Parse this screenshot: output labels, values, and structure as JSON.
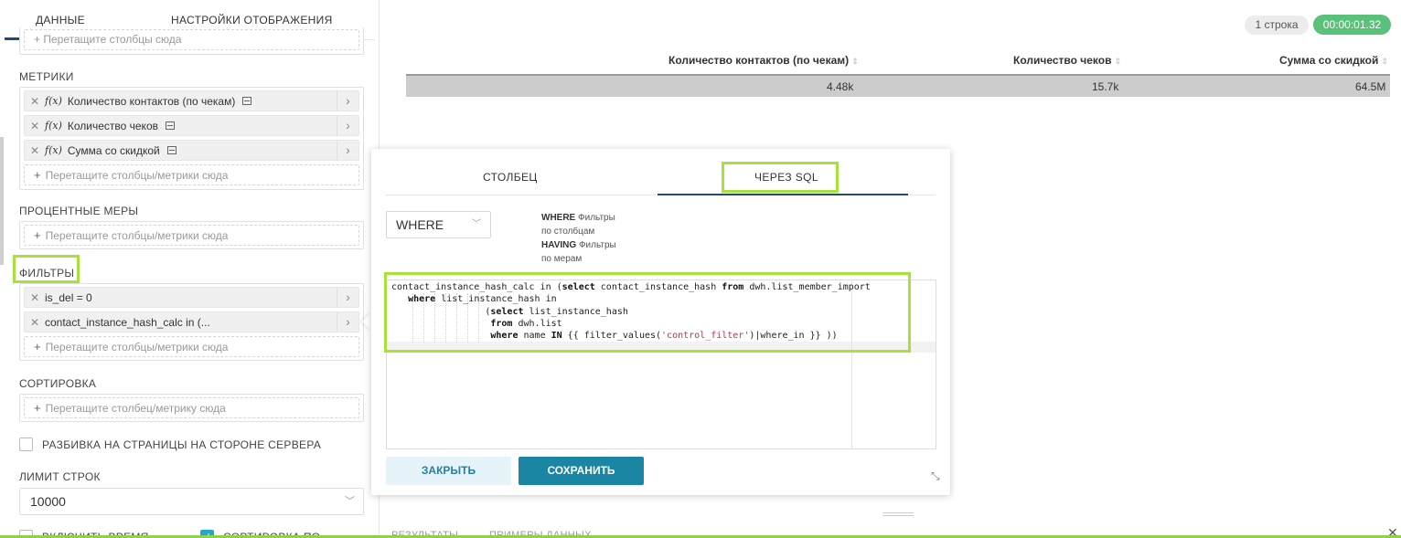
{
  "tabs": {
    "data": "ДАННЫЕ",
    "display": "НАСТРОЙКИ ОТОБРАЖЕНИЯ"
  },
  "columns_dropzone": "+ Перетащите столбцы сюда",
  "metrics": {
    "label": "МЕТРИКИ",
    "items": [
      {
        "fx": "f(x)",
        "name": "Количество контактов (по чекам)"
      },
      {
        "fx": "f(x)",
        "name": "Количество чеков"
      },
      {
        "fx": "f(x)",
        "name": "Сумма со скидкой"
      }
    ],
    "dropzone": "Перетащите столбцы/метрики сюда"
  },
  "percent_metrics": {
    "label": "ПРОЦЕНТНЫЕ МЕРЫ",
    "dropzone": "Перетащите столбцы/метрики сюда"
  },
  "filters": {
    "label": "ФИЛЬТРЫ",
    "items": [
      "is_del = 0",
      "contact_instance_hash_calc in (..."
    ],
    "dropzone": "Перетащите столбцы/метрики сюда"
  },
  "sorting": {
    "label": "СОРТИРОВКА",
    "dropzone": "Перетащите столбец/метрику сюда"
  },
  "server_pagination": {
    "label": "РАЗБИВКА НА СТРАНИЦЫ НА СТОРОНЕ СЕРВЕРА",
    "checked": false
  },
  "row_limit": {
    "label": "ЛИМИТ СТРОК",
    "value": "10000"
  },
  "bottom_options": {
    "include_time": "ВКЛЮЧИТЬ ВРЕМЯ",
    "sort_by": "СОРТИРОВКА ПО"
  },
  "results": {
    "row_count": "1 строка",
    "elapsed": "00:00:01.32",
    "headers": [
      "Количество контактов (по чекам)",
      "Количество чеков",
      "Сумма со скидкой"
    ],
    "row": [
      "4.48k",
      "15.7k",
      "64.5M"
    ]
  },
  "popover": {
    "tabs": {
      "column": "СТОЛБЕЦ",
      "sql": "ЧЕРЕЗ SQL"
    },
    "clause": "WHERE",
    "hint": {
      "where_kw": "WHERE",
      "where_1": "Фильтры",
      "where_2": "по столбцам",
      "having_kw": "HAVING",
      "having_1": "Фильтры",
      "having_2": "по мерам"
    },
    "sql_lines": [
      "contact_instance_hash_calc in (select contact_instance_hash from dwh.list_member_import",
      "   where list_instance_hash in",
      "                 (select list_instance_hash",
      "                  from dwh.list",
      "                  where name IN {{ filter_values('control_filter')|where_in }} ))"
    ],
    "close_label": "ЗАКРЫТЬ",
    "save_label": "СОХРАНИТЬ"
  },
  "bottom_tabs": {
    "results": "РЕЗУЛЬТАТЫ",
    "samples": "ПРИМЕРЫ ДАННЫХ"
  },
  "colors": {
    "accent": "#1a86a3",
    "highlight": "#a8e03c",
    "time_badge": "#5ac17a"
  }
}
